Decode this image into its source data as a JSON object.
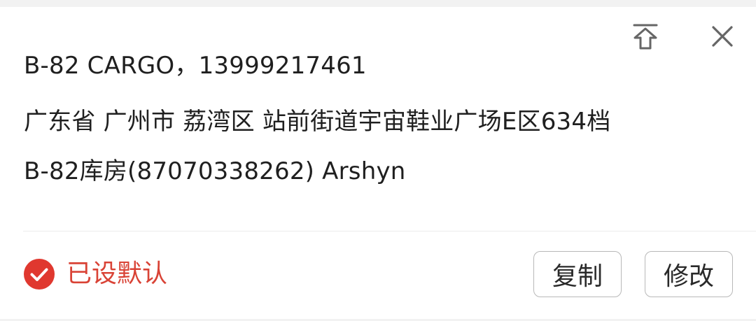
{
  "address_card": {
    "recipient_line": "B-82 CARGO，13999217461",
    "address_line": "广东省 广州市 荔湾区 站前街道宇宙鞋业广场E区634档",
    "detail_line": "B-82库房(87070338262) Arshyn"
  },
  "header_icons": {
    "pin": "pin-to-top-icon",
    "close": "close-icon"
  },
  "footer": {
    "default_label": "已设默认",
    "default_checked": true,
    "copy_label": "复制",
    "edit_label": "修改"
  },
  "colors": {
    "accent_red": "#e0382f",
    "text": "#1f1f1f",
    "background": "#ffffff",
    "page_background": "#f2f2f2"
  }
}
